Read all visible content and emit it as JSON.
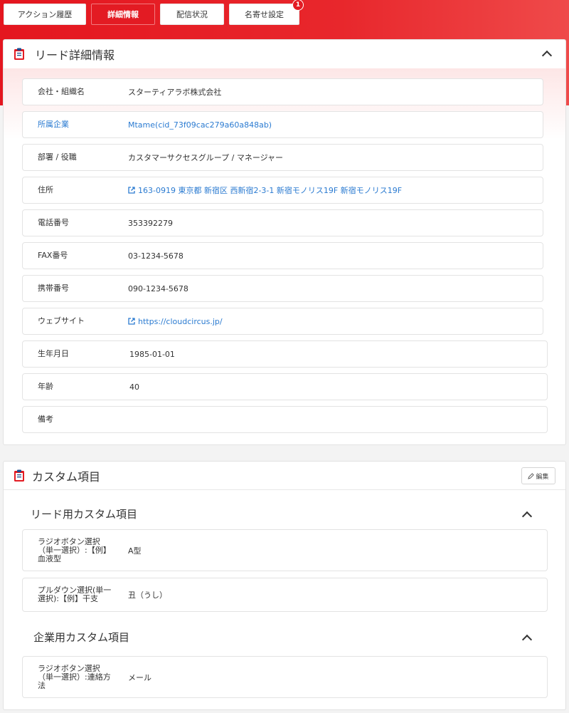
{
  "tabs": [
    {
      "label": "アクション履歴"
    },
    {
      "label": "詳細情報"
    },
    {
      "label": "配信状況"
    },
    {
      "label": "名寄せ設定",
      "badge": "1"
    }
  ],
  "lead_detail": {
    "title": "リード詳細情報",
    "rows": [
      {
        "label": "会社・組織名",
        "value": "スターティアラボ株式会社"
      },
      {
        "label": "所属企業",
        "value": "Mtame(cid_73f09cac279a60a848ab)"
      },
      {
        "label": "部署 / 役職",
        "value": "カスタマーサクセスグループ / マネージャー"
      },
      {
        "label": "住所",
        "value": "163-0919 東京都 新宿区 西新宿2-3-1 新宿モノリス19F 新宿モノリス19F"
      },
      {
        "label": "電話番号",
        "value": "353392279"
      },
      {
        "label": "FAX番号",
        "value": "03-1234-5678"
      },
      {
        "label": "携帯番号",
        "value": "090-1234-5678"
      },
      {
        "label": "ウェブサイト",
        "value": "https://cloudcircus.jp/"
      },
      {
        "label": "生年月日",
        "value": "1985-01-01"
      },
      {
        "label": "年齢",
        "value": "40"
      },
      {
        "label": "備考",
        "value": ""
      }
    ]
  },
  "custom": {
    "title": "カスタム項目",
    "edit_label": "編集",
    "lead_section": {
      "title": "リード用カスタム項目",
      "rows": [
        {
          "label_lines": [
            "ラジオボタン選択",
            "（単一選択）:【例】",
            "血液型"
          ],
          "value": "A型"
        },
        {
          "label_lines": [
            "プルダウン選択(単一",
            "選択):【例】干支"
          ],
          "value": "丑（うし）"
        }
      ]
    },
    "company_section": {
      "title": "企業用カスタム項目",
      "rows": [
        {
          "label_lines": [
            "ラジオボタン選択",
            "（単一選択）:連絡方",
            "法"
          ],
          "value": "メール"
        }
      ]
    }
  },
  "colors": {
    "brand_red": "#e31b23",
    "link_blue": "#2b7bd1"
  }
}
